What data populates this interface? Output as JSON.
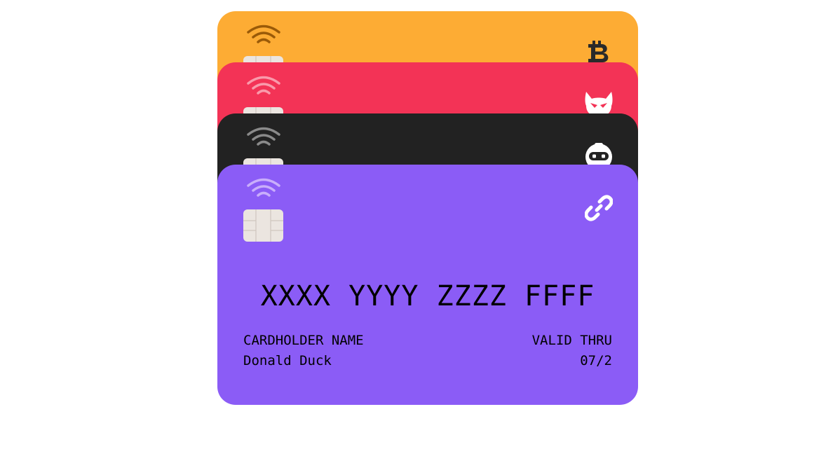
{
  "cards": [
    {
      "color": "#fdac34",
      "brand_icon": "bitcoin-icon"
    },
    {
      "color": "#f33356",
      "brand_icon": "devil-icon"
    },
    {
      "color": "#222222",
      "brand_icon": "robot-icon"
    },
    {
      "color": "#8b5cf6",
      "brand_icon": "link-icon",
      "number": "XXXX YYYY ZZZZ FFFF",
      "holder_label": "CARDHOLDER NAME",
      "holder_name": "Donald Duck",
      "valid_label": "VALID THRU",
      "valid_value": "07/2"
    }
  ]
}
